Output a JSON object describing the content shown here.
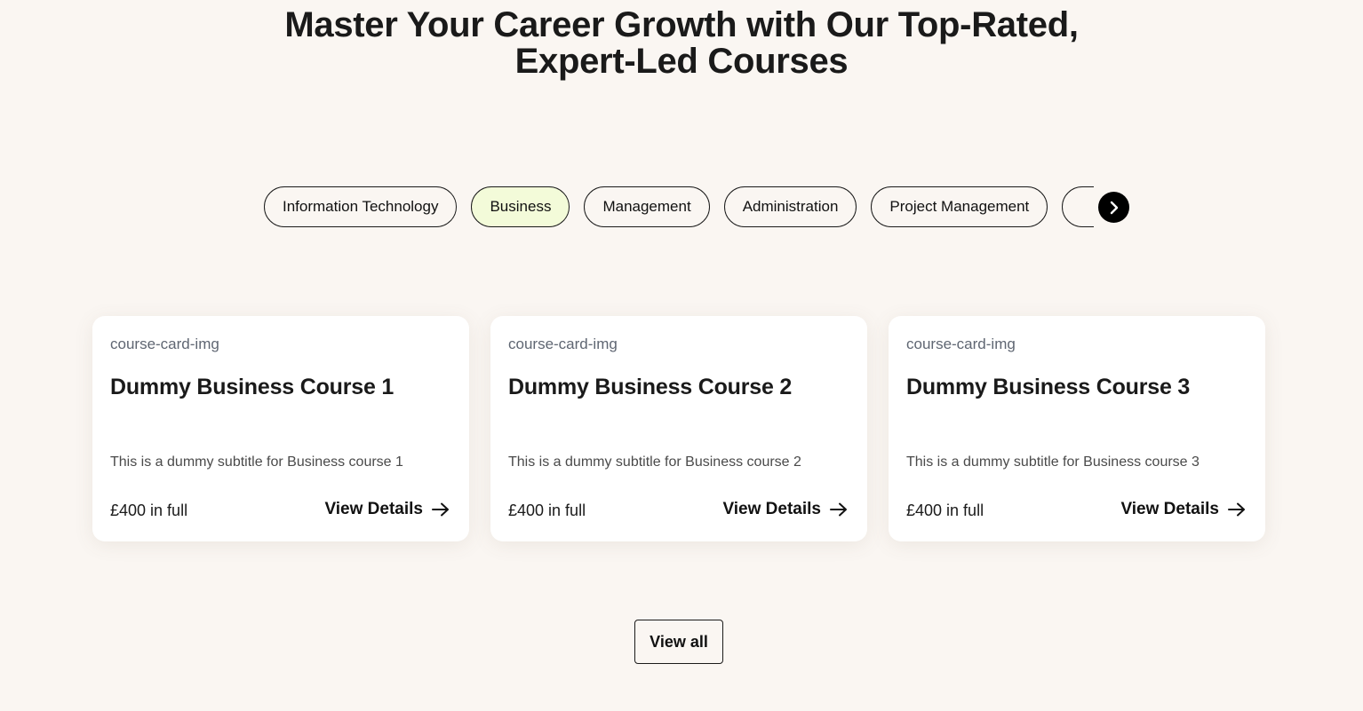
{
  "heading": {
    "line1": "Master Your Career Growth with Our Top-Rated,",
    "line2": "Expert-Led Courses"
  },
  "tabs": [
    {
      "label": "Information Technology",
      "active": false
    },
    {
      "label": "Business",
      "active": true
    },
    {
      "label": "Management",
      "active": false
    },
    {
      "label": "Administration",
      "active": false
    },
    {
      "label": "Project Management",
      "active": false
    },
    {
      "label": "",
      "active": false
    }
  ],
  "tab_scroll_icon": "chevron-right-icon",
  "courses": [
    {
      "image_alt": "course-card-img",
      "title": "Dummy Business Course 1",
      "subtitle": "This is a dummy subtitle for Business course 1",
      "price": "£400 in full",
      "details_label": "View Details",
      "details_icon": "arrow-right-icon"
    },
    {
      "image_alt": "course-card-img",
      "title": "Dummy Business Course 2",
      "subtitle": "This is a dummy subtitle for Business course 2",
      "price": "£400 in full",
      "details_label": "View Details",
      "details_icon": "arrow-right-icon"
    },
    {
      "image_alt": "course-card-img",
      "title": "Dummy Business Course 3",
      "subtitle": "This is a dummy subtitle for Business course 3",
      "price": "£400 in full",
      "details_label": "View Details",
      "details_icon": "arrow-right-icon"
    }
  ],
  "view_all_label": "View all",
  "colors": {
    "background": "#faf6f2",
    "active_tab": "#f3fbd9",
    "card": "#ffffff",
    "text": "#1a1a1a"
  }
}
